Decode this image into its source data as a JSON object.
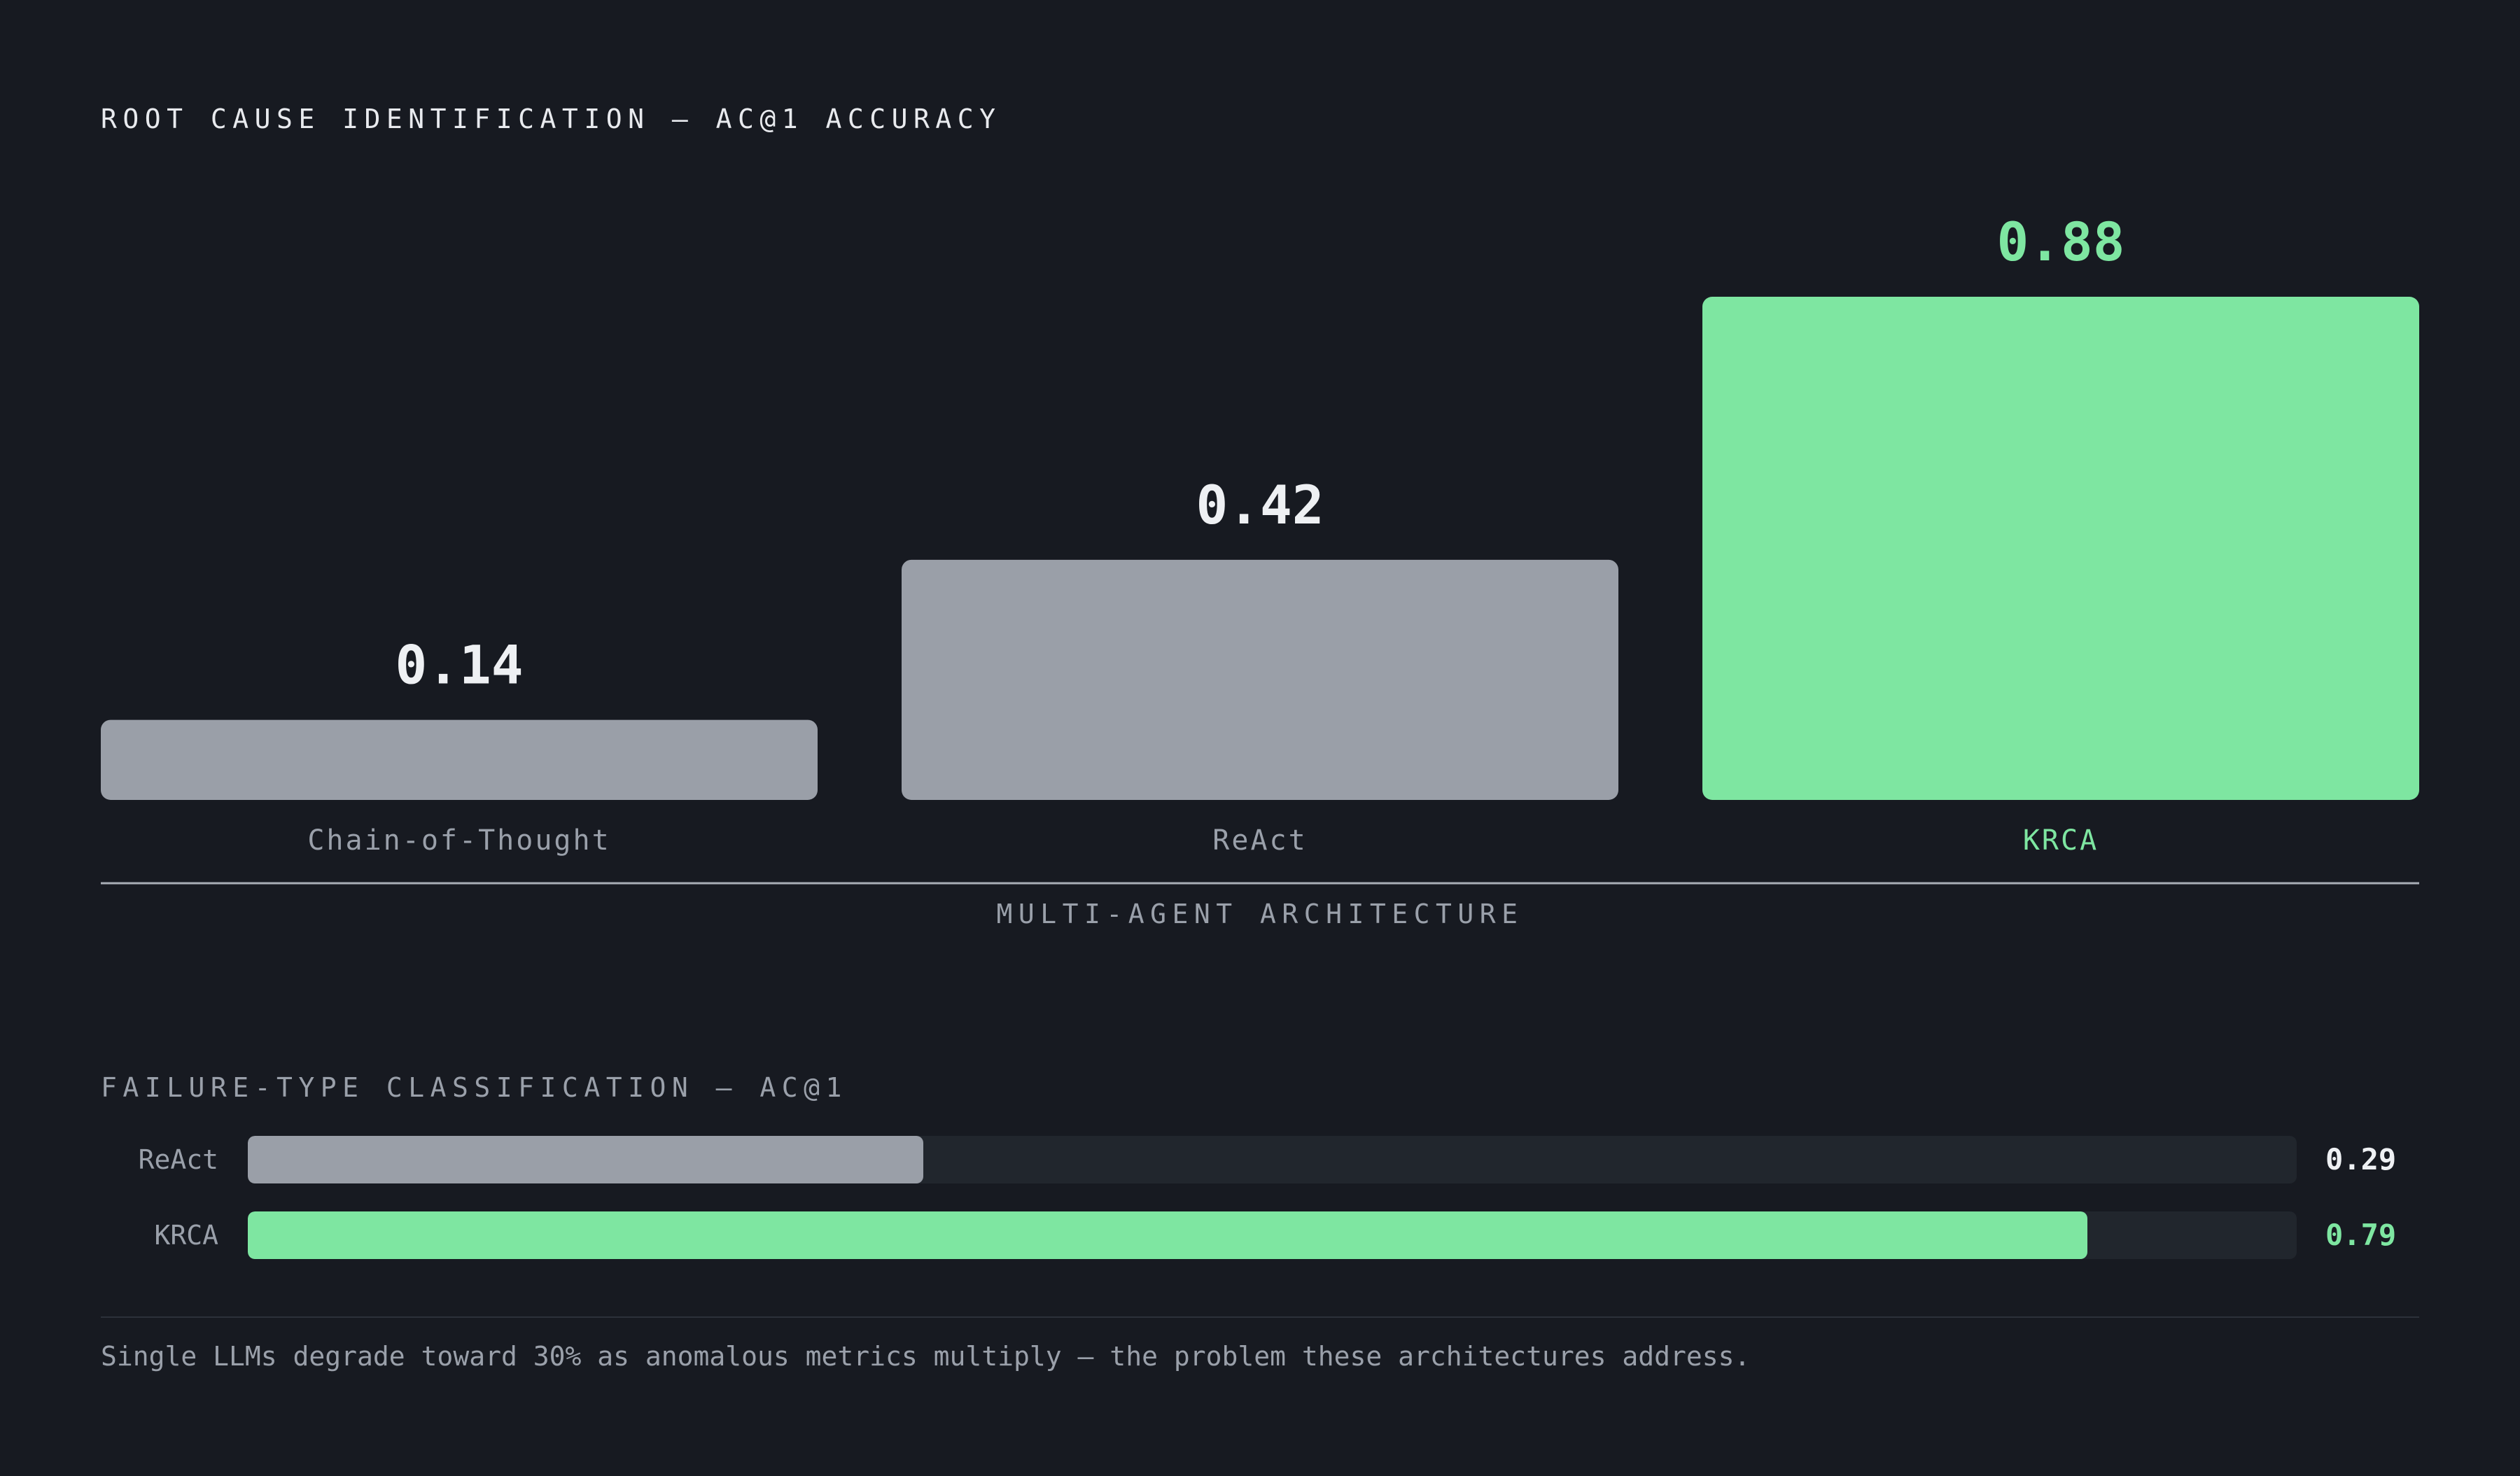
{
  "section1": {
    "title": "ROOT CAUSE IDENTIFICATION — AC@1 ACCURACY"
  },
  "colors": {
    "background": "#171a21",
    "accent": "#7ee6a1",
    "neutral_bar": "#9a9fa8",
    "value_text": "#eef0f3",
    "muted_text": "#9aa0aa",
    "track": "#21262d"
  },
  "chart_data": [
    {
      "type": "bar",
      "title": "ROOT CAUSE IDENTIFICATION — AC@1 ACCURACY",
      "xlabel": "MULTI-AGENT ARCHITECTURE",
      "ylabel": "",
      "categories": [
        "Chain-of-Thought",
        "ReAct",
        "KRCA"
      ],
      "values": [
        0.14,
        0.42,
        0.88
      ],
      "value_labels": [
        "0.14",
        "0.42",
        "0.88"
      ],
      "highlight": "KRCA",
      "ylim": [
        0,
        1
      ],
      "grid": false,
      "legend": "none"
    },
    {
      "type": "bar",
      "orientation": "horizontal",
      "title": "FAILURE-TYPE CLASSIFICATION — AC@1",
      "categories": [
        "ReAct",
        "KRCA"
      ],
      "values": [
        0.29,
        0.79
      ],
      "value_labels": [
        "0.29",
        "0.79"
      ],
      "highlight": "KRCA",
      "xlim": [
        0,
        0.88
      ],
      "grid": false,
      "legend": "none"
    }
  ],
  "section2": {
    "title": "FAILURE-TYPE CLASSIFICATION — AC@1"
  },
  "footnote": "Single LLMs degrade toward 30% as anomalous metrics multiply — the problem these architectures address."
}
